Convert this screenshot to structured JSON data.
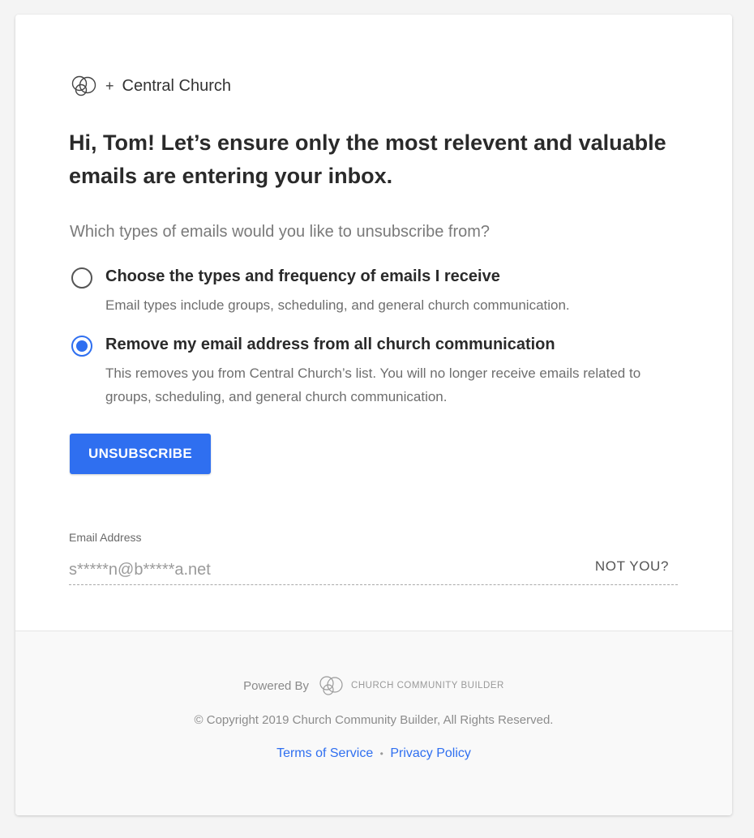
{
  "header": {
    "plus_sign": "+",
    "church_name": "Central Church"
  },
  "headline": "Hi, Tom! Let’s ensure only the most relevent and valuable emails are entering your inbox.",
  "question": "Which types of emails would you like to unsubscribe from?",
  "options": [
    {
      "label": "Choose the types and frequency of emails I receive",
      "description": "Email types include groups, scheduling, and general church communication.",
      "selected": false
    },
    {
      "label": "Remove my email address from all church communication",
      "description": "This removes you from Central Church’s list. You will no longer receive emails related to groups, scheduling, and general church communication.",
      "selected": true
    }
  ],
  "unsubscribe_button": "UNSUBSCRIBE",
  "email": {
    "label": "Email Address",
    "value": "s*****n@b*****a.net",
    "not_you": "NOT YOU?"
  },
  "footer": {
    "powered_by": "Powered By",
    "brand": "CHURCH COMMUNITY BUILDER",
    "copyright": "© Copyright 2019 Church Community Builder, All Rights Reserved.",
    "terms": "Terms of Service",
    "separator": "•",
    "privacy": "Privacy Policy"
  },
  "colors": {
    "accent": "#2f6ff0",
    "background": "#f4f4f4",
    "footer_background": "#f9f9f9"
  },
  "icons": {
    "church_logo": "ccb-rings-icon",
    "footer_logo": "ccb-rings-icon"
  }
}
